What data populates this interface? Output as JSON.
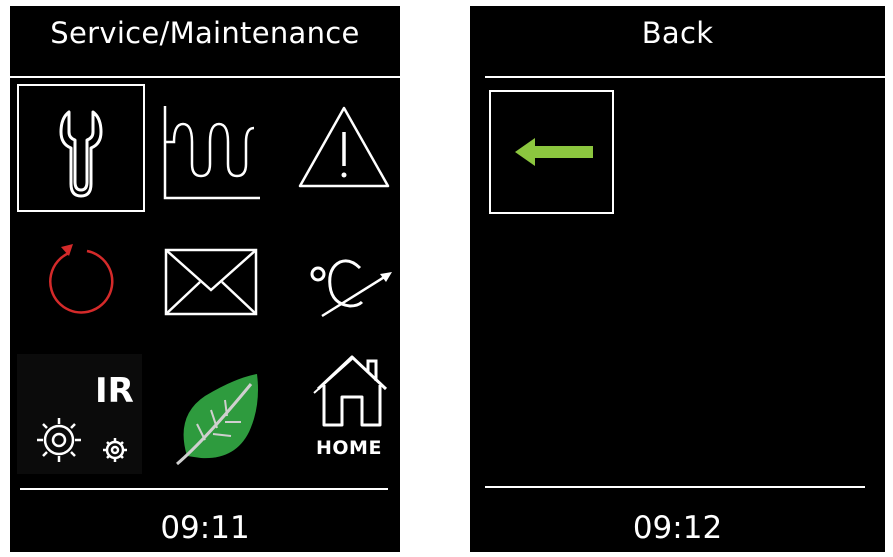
{
  "screens": [
    {
      "title": "Service/Maintenance",
      "time": "09:11",
      "icons": [
        {
          "name": "wrench-icon",
          "selected": true
        },
        {
          "name": "heating-curve-icon"
        },
        {
          "name": "warning-icon"
        },
        {
          "name": "reset-icon",
          "color": "#d42a2a"
        },
        {
          "name": "mail-icon"
        },
        {
          "name": "temperature-setpoint-icon"
        },
        {
          "name": "ir-settings-icon",
          "label": "IR"
        },
        {
          "name": "eco-leaf-icon",
          "color": "#2e9b3e"
        },
        {
          "name": "home-icon",
          "label": "HOME"
        }
      ]
    },
    {
      "title": "Back",
      "time": "09:12",
      "icons": [
        {
          "name": "back-arrow-icon",
          "color": "#8cc63f",
          "selected": true
        }
      ]
    }
  ]
}
